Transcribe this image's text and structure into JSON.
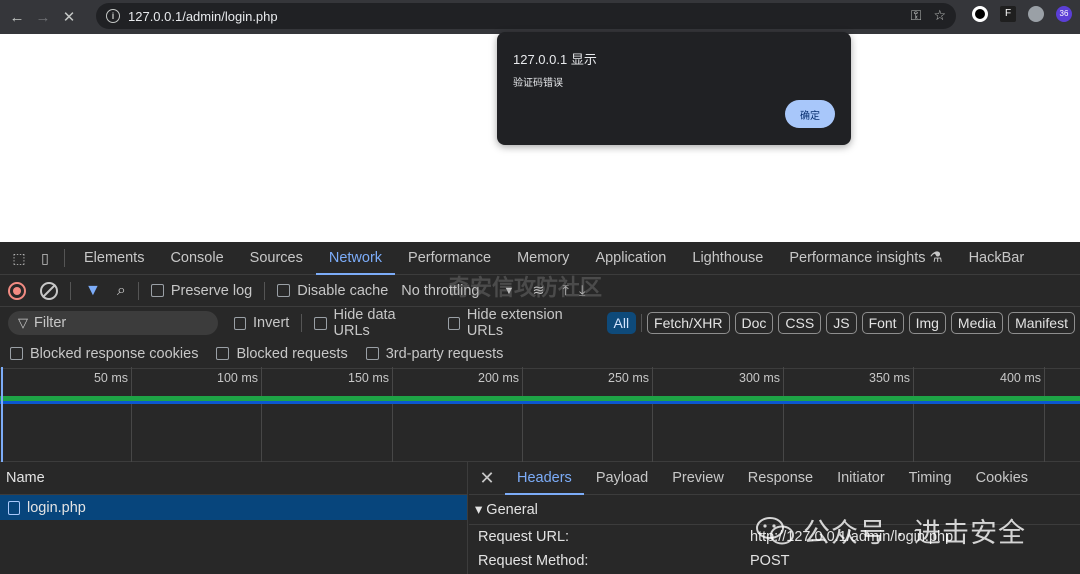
{
  "browser": {
    "url": "127.0.0.1/admin/login.php",
    "ext_badge": "36"
  },
  "dialog": {
    "title": "127.0.0.1 显示",
    "message": "验证码错误",
    "ok_label": "确定"
  },
  "devtools": {
    "tabs": [
      "Elements",
      "Console",
      "Sources",
      "Network",
      "Performance",
      "Memory",
      "Application",
      "Lighthouse",
      "Performance insights",
      "HackBar"
    ],
    "active_tab": "Network",
    "toolbar": {
      "preserve_log": "Preserve log",
      "disable_cache": "Disable cache",
      "throttling": "No throttling"
    },
    "filter": {
      "placeholder": "Filter",
      "invert": "Invert",
      "hide_data_urls": "Hide data URLs",
      "hide_extension_urls": "Hide extension URLs",
      "types": [
        "All",
        "Fetch/XHR",
        "Doc",
        "CSS",
        "JS",
        "Font",
        "Img",
        "Media",
        "Manifest"
      ]
    },
    "row3": {
      "blocked_cookies": "Blocked response cookies",
      "blocked_requests": "Blocked requests",
      "third_party": "3rd-party requests"
    },
    "timeline_ticks": [
      "50 ms",
      "100 ms",
      "150 ms",
      "200 ms",
      "250 ms",
      "300 ms",
      "350 ms",
      "400 ms"
    ],
    "name_header": "Name",
    "requests": [
      "login.php"
    ],
    "detail_tabs": [
      "Headers",
      "Payload",
      "Preview",
      "Response",
      "Initiator",
      "Timing",
      "Cookies"
    ],
    "general_label": "▾ General",
    "general": [
      {
        "key": "Request URL:",
        "value": "http://127.0.0.1/admin/login.php"
      },
      {
        "key": "Request Method:",
        "value": "POST"
      }
    ]
  },
  "watermark": {
    "text": "公众号 · 进击安全",
    "faint": "奇安信攻防社区"
  }
}
